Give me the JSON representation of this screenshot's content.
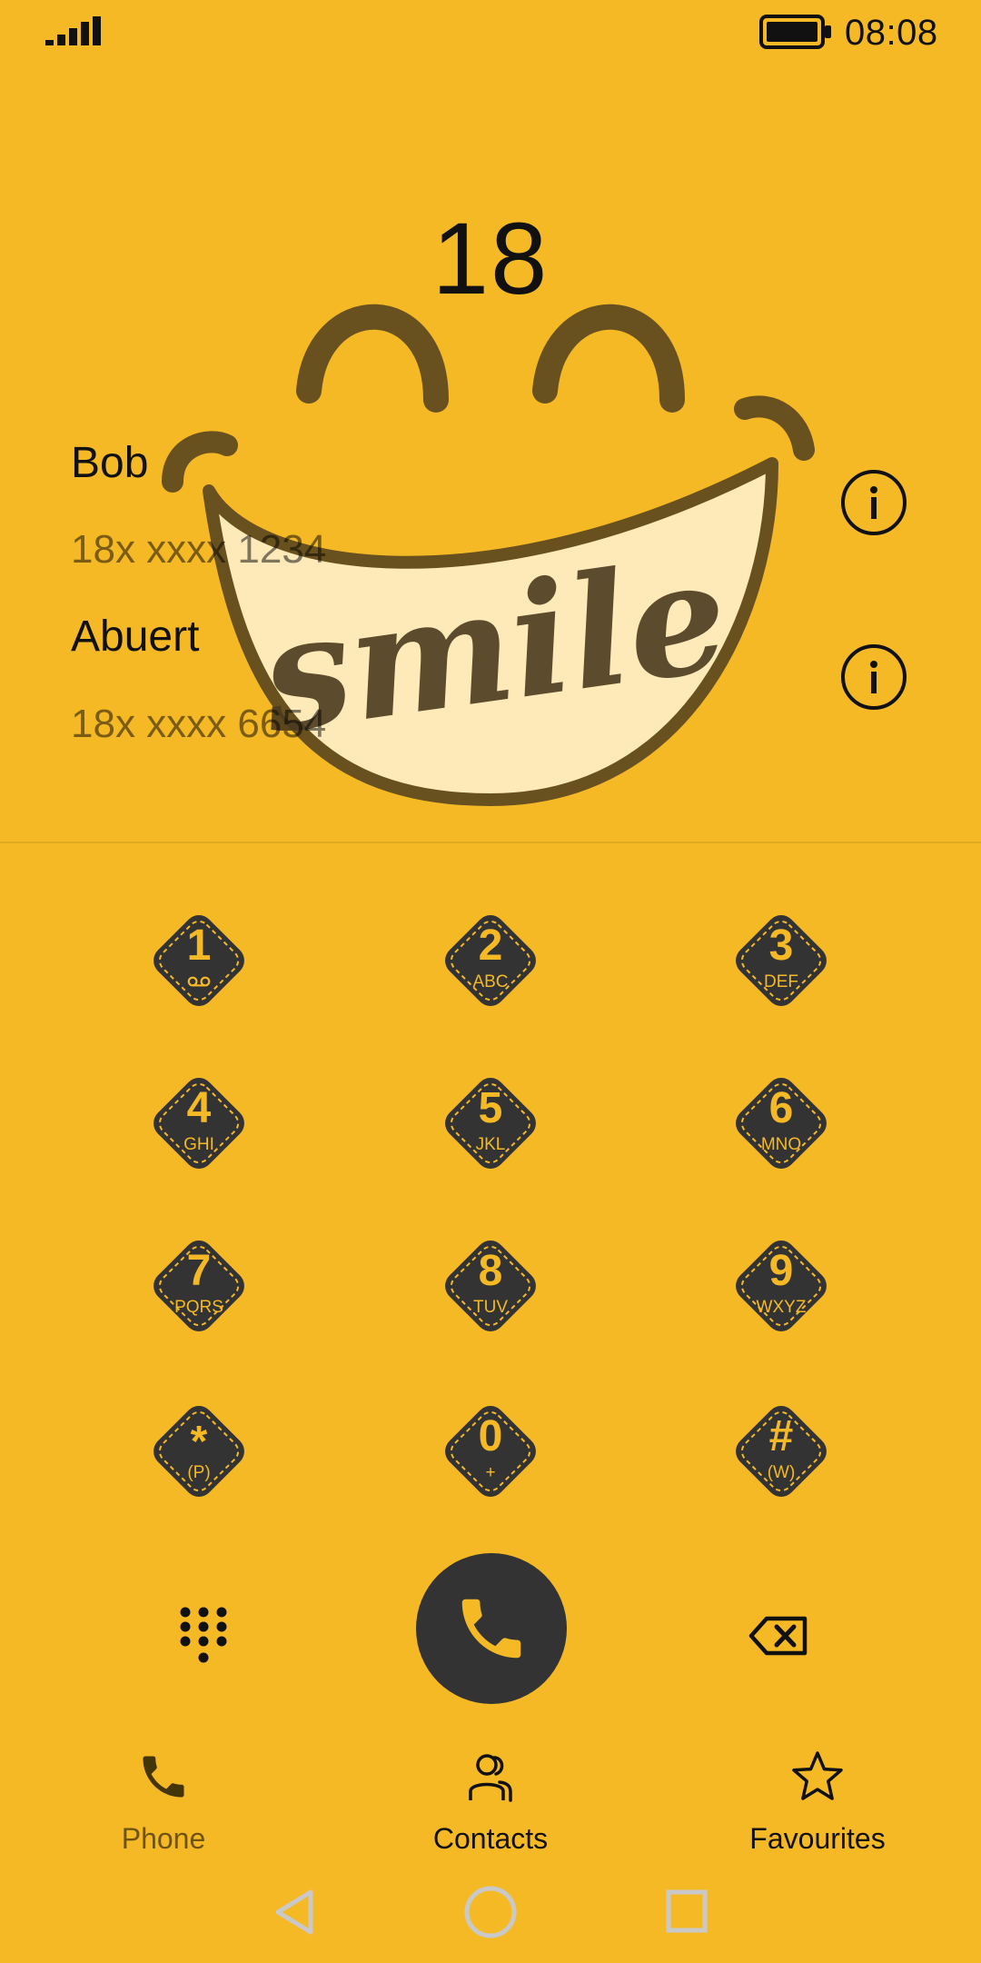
{
  "status_bar": {
    "time": "08:08",
    "signal_icon": "signal-icon",
    "battery_icon": "battery-icon"
  },
  "dialer": {
    "dialed_number": "18"
  },
  "matches": [
    {
      "name": "Bob",
      "number": "18x xxxx 1234",
      "info_icon": "info-icon"
    },
    {
      "name": "Abuert",
      "number": "18x xxxx 6654",
      "info_icon": "info-icon"
    }
  ],
  "keypad": [
    {
      "digit": "1",
      "letters": "",
      "sub_icon": "voicemail-icon"
    },
    {
      "digit": "2",
      "letters": "ABC"
    },
    {
      "digit": "3",
      "letters": "DEF"
    },
    {
      "digit": "4",
      "letters": "GHI"
    },
    {
      "digit": "5",
      "letters": "JKL"
    },
    {
      "digit": "6",
      "letters": "MNO"
    },
    {
      "digit": "7",
      "letters": "PQRS"
    },
    {
      "digit": "8",
      "letters": "TUV"
    },
    {
      "digit": "9",
      "letters": "WXYZ"
    },
    {
      "digit": "*",
      "letters": "(P)"
    },
    {
      "digit": "0",
      "letters": "+"
    },
    {
      "digit": "#",
      "letters": "(W)"
    }
  ],
  "actions": {
    "dialpad_icon": "dialpad-icon",
    "call_icon": "phone-icon",
    "backspace_icon": "backspace-icon"
  },
  "bottom_nav": [
    {
      "label": "Phone",
      "icon": "phone-icon",
      "active": true
    },
    {
      "label": "Contacts",
      "icon": "contacts-icon",
      "active": false
    },
    {
      "label": "Favourites",
      "icon": "star-icon",
      "active": false
    }
  ],
  "decoration": {
    "smile_text": "smile"
  },
  "colors": {
    "background": "#F5B925",
    "key_fill": "#333333",
    "accent_text": "#F5B925",
    "smile_dark": "#4A3A1E",
    "smile_teeth": "#FFF5D9"
  }
}
